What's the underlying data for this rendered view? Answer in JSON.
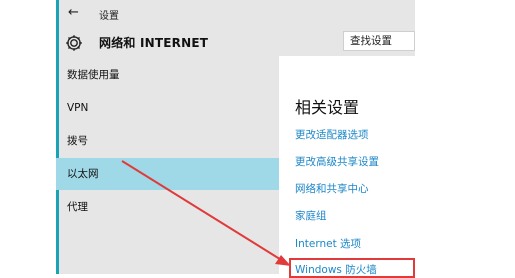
{
  "window": {
    "back_icon": "arrow-left-icon",
    "app_title": "设置"
  },
  "header": {
    "icon": "gear-icon",
    "title": "网络和 INTERNET",
    "search_placeholder": "查找设置"
  },
  "sidebar": {
    "items": [
      {
        "label": "数据使用量",
        "selected": false
      },
      {
        "label": "VPN",
        "selected": false
      },
      {
        "label": "拨号",
        "selected": false
      },
      {
        "label": "以太网",
        "selected": true
      },
      {
        "label": "代理",
        "selected": false
      }
    ]
  },
  "related": {
    "title": "相关设置",
    "links": [
      {
        "label": "更改适配器选项"
      },
      {
        "label": "更改高级共享设置"
      },
      {
        "label": "网络和共享中心"
      },
      {
        "label": "家庭组"
      },
      {
        "label": "Internet 选项"
      },
      {
        "label": "Windows 防火墙"
      }
    ]
  },
  "colors": {
    "accent": "#18a3b8",
    "selected_bg": "#9fd8e6",
    "link": "#1c87c9",
    "annotation": "#e03a3a",
    "pane_bg": "#e6e6e6"
  }
}
